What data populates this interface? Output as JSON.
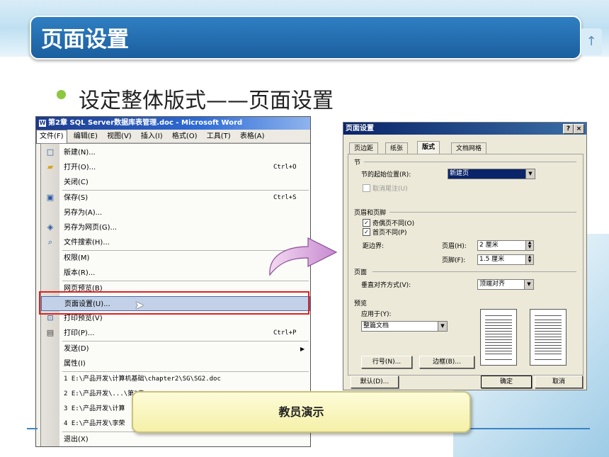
{
  "slide": {
    "title": "页面设置",
    "bullet": "设定整体版式——页面设置",
    "demo_button": "教员演示",
    "corner_icon": "up-arrow-icon"
  },
  "word": {
    "window_title": "第2章  SQL Server数据库表管理.doc - Microsoft Word",
    "menubar": [
      "文件(F)",
      "编辑(E)",
      "视图(V)",
      "插入(I)",
      "格式(O)",
      "工具(T)",
      "表格(A)"
    ],
    "file_menu": {
      "new": {
        "label": "新建(N)...",
        "shortcut": ""
      },
      "open": {
        "label": "打开(O)...",
        "shortcut": "Ctrl+O"
      },
      "close": {
        "label": "关闭(C)",
        "shortcut": ""
      },
      "save": {
        "label": "保存(S)",
        "shortcut": "Ctrl+S"
      },
      "save_as": {
        "label": "另存为(A)...",
        "shortcut": ""
      },
      "save_as_web": {
        "label": "另存为网页(G)...",
        "shortcut": ""
      },
      "file_search": {
        "label": "文件搜索(H)...",
        "shortcut": ""
      },
      "permission": {
        "label": "权限(M)",
        "shortcut": ""
      },
      "versions": {
        "label": "版本(R)...",
        "shortcut": ""
      },
      "web_preview": {
        "label": "网页预览(B)",
        "shortcut": ""
      },
      "page_setup": {
        "label": "页面设置(U)...",
        "shortcut": ""
      },
      "print_preview": {
        "label": "打印预览(V)",
        "shortcut": ""
      },
      "print": {
        "label": "打印(P)...",
        "shortcut": "Ctrl+P"
      },
      "send_to": {
        "label": "发送(D)",
        "shortcut": ""
      },
      "properties": {
        "label": "属性(I)",
        "shortcut": ""
      },
      "recent1": {
        "label": "1 E:\\产品开发\\计算机基础\\chapter2\\SG\\SG2.doc",
        "shortcut": ""
      },
      "recent2": {
        "label": "2 E:\\产品开发\\...\\第2章...",
        "shortcut": ""
      },
      "recent3": {
        "label": "3 E:\\产品开发\\计算",
        "shortcut": ""
      },
      "recent4": {
        "label": "4 E:\\产品开发\\李荣",
        "shortcut": ""
      },
      "exit": {
        "label": "退出(X)",
        "shortcut": ""
      }
    }
  },
  "dialog": {
    "title": "页面设置",
    "tabs": [
      "页边距",
      "纸张",
      "版式",
      "文档网格"
    ],
    "active_tab": "版式",
    "section_group": "节",
    "section_start_label": "节的起始位置(R):",
    "section_start_value": "新建页",
    "suppress_endnotes": "取消尾注(U)",
    "header_footer_group": "页眉和页脚",
    "odd_even": "奇偶页不同(O)",
    "first_page": "首页不同(P)",
    "from_edge": "距边界:",
    "header_label": "页眉(H):",
    "header_value": "2 厘米",
    "footer_label": "页脚(F):",
    "footer_value": "1.5 厘米",
    "page_group": "页面",
    "valign_label": "垂直对齐方式(V):",
    "valign_value": "顶端对齐",
    "preview_group": "预览",
    "apply_label": "应用于(Y):",
    "apply_value": "整篇文档",
    "line_numbers_button": "行号(N)...",
    "borders_button": "边框(B)...",
    "default_button": "默认(D)...",
    "ok_button": "确定",
    "cancel_button": "取消",
    "help_button": "?",
    "close_button": "×"
  }
}
